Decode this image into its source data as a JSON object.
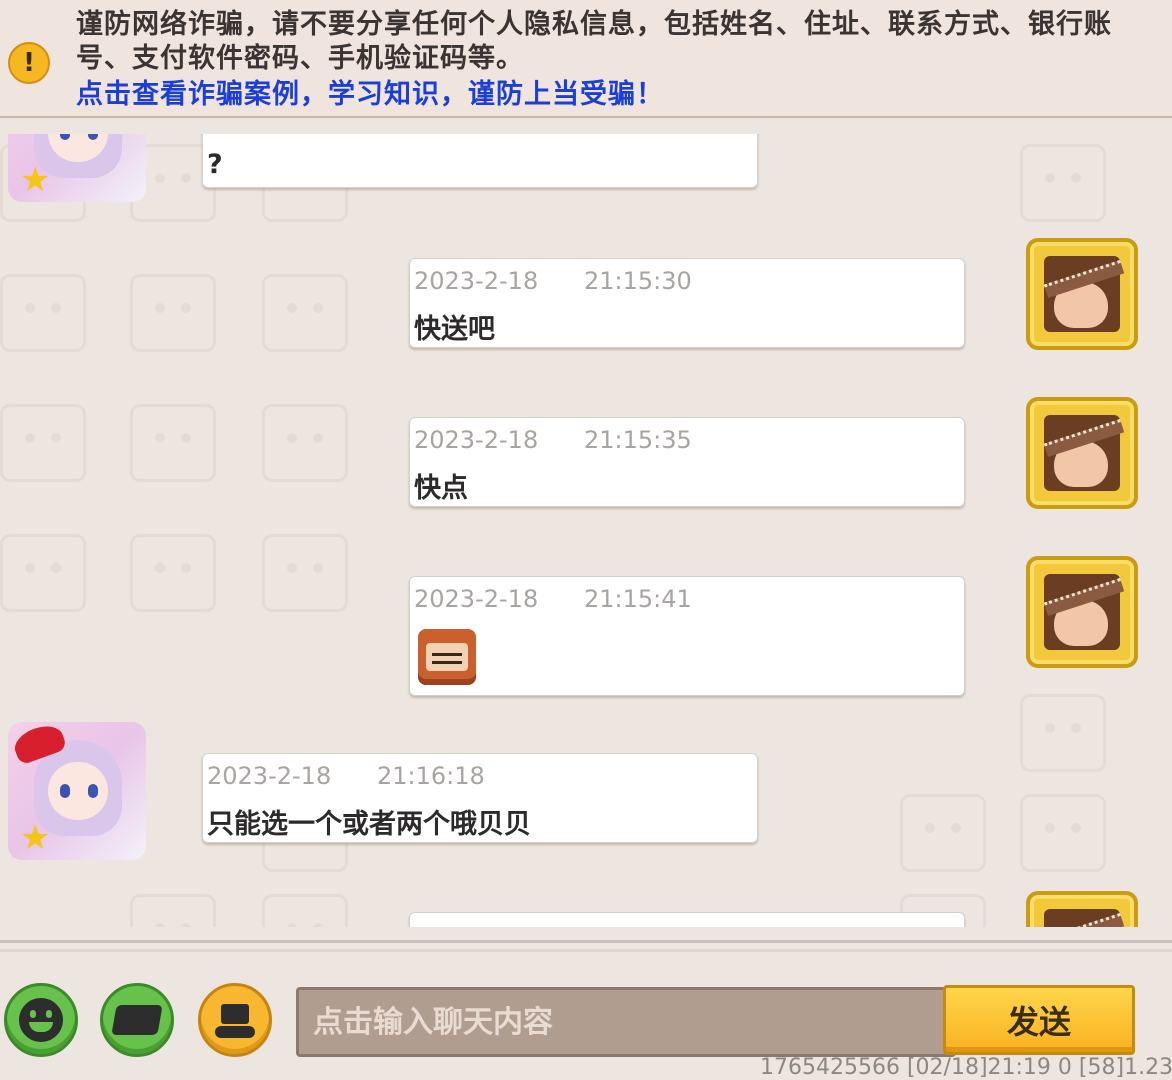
{
  "banner": {
    "warning_text": "谨防网络诈骗，请不要分享任何个人隐私信息，包括姓名、住址、联系方式、银行账号、支付软件密码、手机验证码等。",
    "link_text": "点击查看诈骗案例，学习知识，谨防上当受骗！",
    "icon": "exclamation-icon",
    "icon_glyph": "!",
    "link_color": "#1b3fd6"
  },
  "messages": [
    {
      "sender": "other",
      "meta": "",
      "text": "?"
    },
    {
      "sender": "me",
      "meta": "2023-2-18      21:15:30",
      "text": "快送吧"
    },
    {
      "sender": "me",
      "meta": "2023-2-18      21:15:35",
      "text": "快点"
    },
    {
      "sender": "me",
      "meta": "2023-2-18      21:15:41",
      "text": "",
      "sticker": "cartoon-sticker"
    },
    {
      "sender": "other",
      "meta": "2023-2-18      21:16:18",
      "text": "只能选一个或者两个哦贝贝"
    },
    {
      "sender": "me",
      "meta": "",
      "text": ""
    }
  ],
  "input": {
    "placeholder": "点击输入聊天内容",
    "value": ""
  },
  "toolbar": {
    "emoji_icon": "smiley-icon",
    "card_icon": "card-icon",
    "gift_icon": "gift-hand-icon",
    "send_label": "发送"
  },
  "footer": {
    "info": "1765425566   [02/18]21:19 0  [58]1.23."
  },
  "colors": {
    "background": "#ede6e0",
    "send_button": "#f8b221",
    "input_bg": "#b19d90",
    "green_button": "#66c24a",
    "orange_button": "#f7b731"
  }
}
